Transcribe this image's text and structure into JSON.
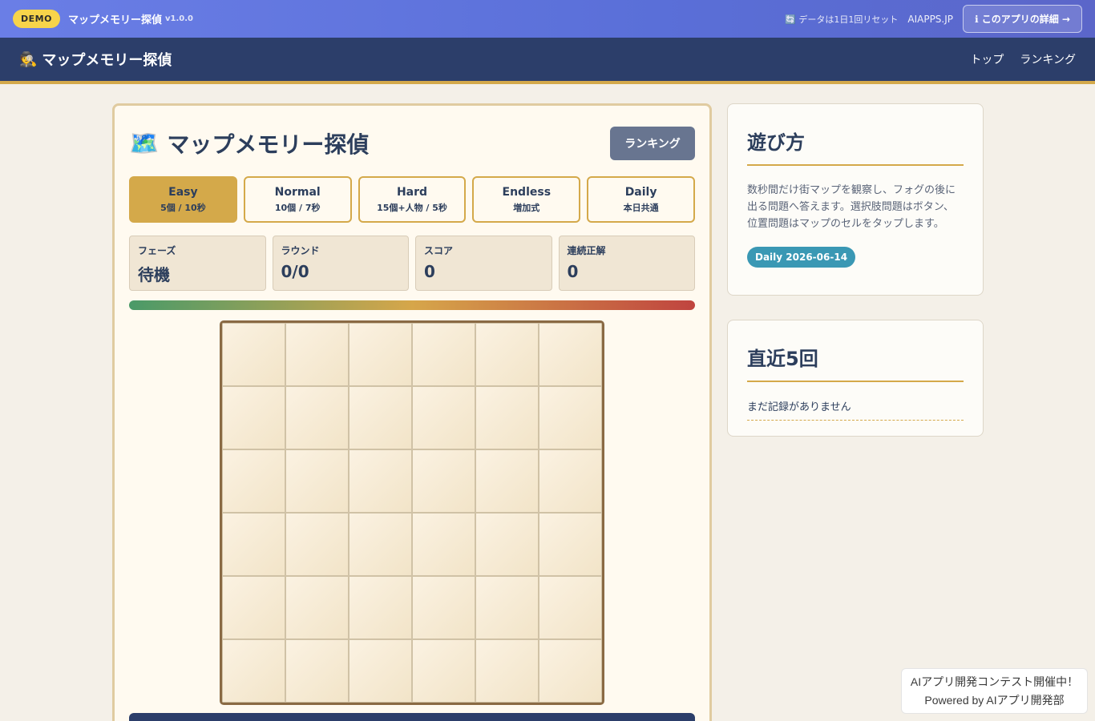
{
  "demo_bar": {
    "badge": "DEMO",
    "app_title": "マップメモリー探偵",
    "version": "v1.0.0",
    "reset_note": "🔄 データは1日1回リセット",
    "site": "AIAPPS.JP",
    "detail_button": "ℹ このアプリの詳細 →"
  },
  "nav": {
    "brand_icon": "🕵",
    "brand": "マップメモリー探偵",
    "links": [
      "トップ",
      "ランキング"
    ]
  },
  "main": {
    "title_icon": "🗺️",
    "title": "マップメモリー探偵",
    "ranking_button": "ランキング",
    "modes": [
      {
        "name": "Easy",
        "sub": "5個 / 10秒",
        "active": true
      },
      {
        "name": "Normal",
        "sub": "10個 / 7秒",
        "active": false
      },
      {
        "name": "Hard",
        "sub": "15個+人物 / 5秒",
        "active": false
      },
      {
        "name": "Endless",
        "sub": "増加式",
        "active": false
      },
      {
        "name": "Daily",
        "sub": "本日共通",
        "active": false
      }
    ],
    "stats": [
      {
        "label": "フェーズ",
        "value": "待機"
      },
      {
        "label": "ラウンド",
        "value": "0/0"
      },
      {
        "label": "スコア",
        "value": "0"
      },
      {
        "label": "連続正解",
        "value": "0"
      }
    ],
    "board": {
      "rows": 6,
      "cols": 6
    }
  },
  "howto": {
    "title": "遊び方",
    "text": "数秒間だけ街マップを観察し、フォグの後に出る問題へ答えます。選択肢問題はボタン、位置問題はマップのセルをタップします。",
    "daily_badge": "Daily 2026-06-14"
  },
  "recent": {
    "title": "直近5回",
    "empty": "まだ記録がありません"
  },
  "contest": {
    "line1": "AIアプリ開発コンテスト開催中！",
    "line2": "Powered by AIアプリ開発部"
  },
  "colors": {
    "accent": "#d4a94a",
    "navy": "#2c3e6a",
    "demo_gradient_start": "#6a7ee6",
    "daily_badge": "#3a98b4"
  }
}
